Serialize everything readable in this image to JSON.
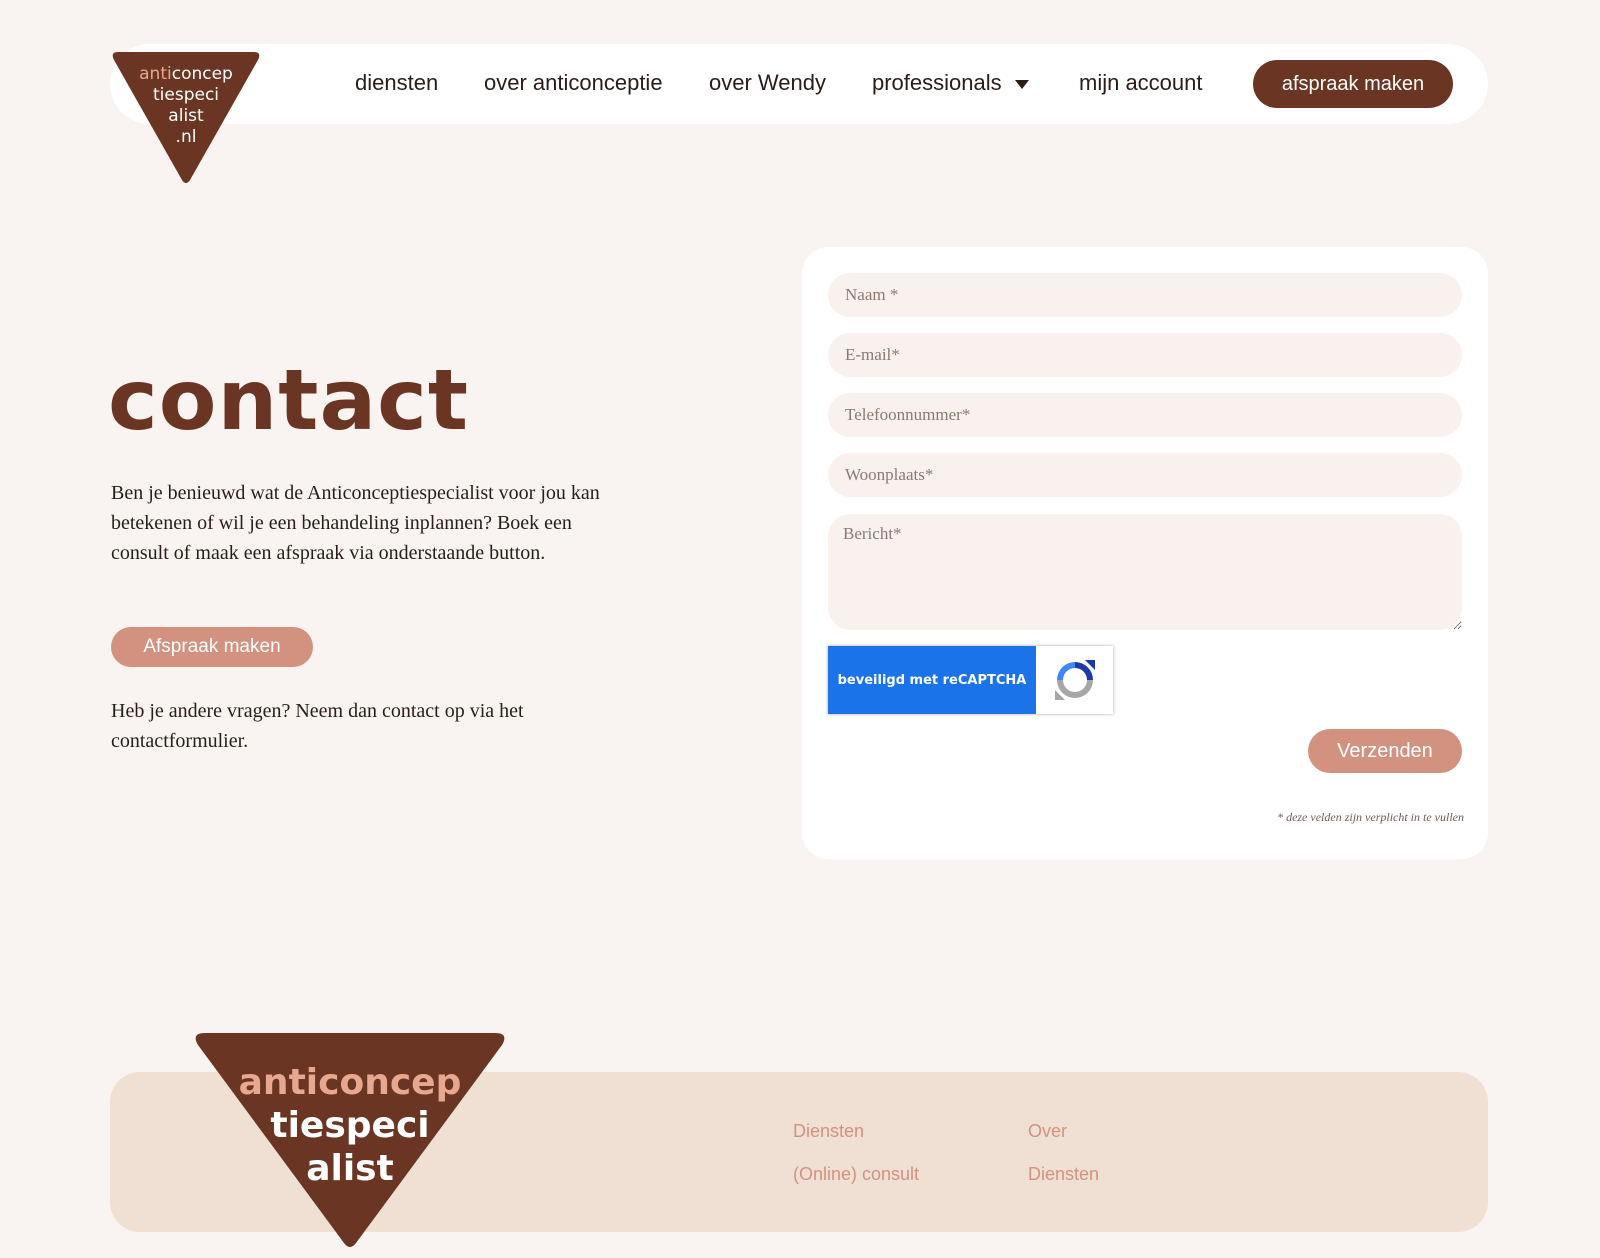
{
  "header": {
    "logo": {
      "line1_accent": "anti",
      "line1_rest": "concep",
      "line2": "tiespeci",
      "line3": "alist",
      "line4": ".nl"
    },
    "nav": [
      {
        "label": "diensten"
      },
      {
        "label": "over anticonceptie"
      },
      {
        "label": "over Wendy"
      },
      {
        "label": "professionals",
        "has_dropdown": true
      },
      {
        "label": "mijn account"
      }
    ],
    "cta_label": "afspraak maken"
  },
  "main": {
    "title": "contact",
    "intro": "Ben je benieuwd wat de Anticonceptiespecialist voor jou kan betekenen of wil je een behandeling inplannen? Boek een consult of maak een afspraak via onderstaande button.",
    "cta_label": "Afspraak maken",
    "outro": "Heb je andere vragen? Neem dan contact op via het contactformulier."
  },
  "form": {
    "fields": [
      {
        "placeholder": "Naam *"
      },
      {
        "placeholder": "E-mail*"
      },
      {
        "placeholder": "Telefoonnummer*"
      },
      {
        "placeholder": "Woonplaats*"
      },
      {
        "placeholder": "Bericht*"
      }
    ],
    "recaptcha_label": "beveiligd met reCAPTCHA",
    "submit_label": "Verzenden",
    "required_note": "* deze velden zijn verplicht in te vullen"
  },
  "footer": {
    "logo": {
      "line1_accent": "anti",
      "line1_rest": "concep",
      "line2": "tiespeci",
      "line3": "alist"
    },
    "col1": [
      "Diensten",
      "(Online) consult"
    ],
    "col2": [
      "Over",
      "Diensten"
    ]
  },
  "colors": {
    "page_bg": "#f9f3f1",
    "brand_brown": "#6a3522",
    "accent_salmon": "#d39280",
    "footer_bg": "#efe0d3",
    "recaptcha_blue": "#1a73e8"
  }
}
